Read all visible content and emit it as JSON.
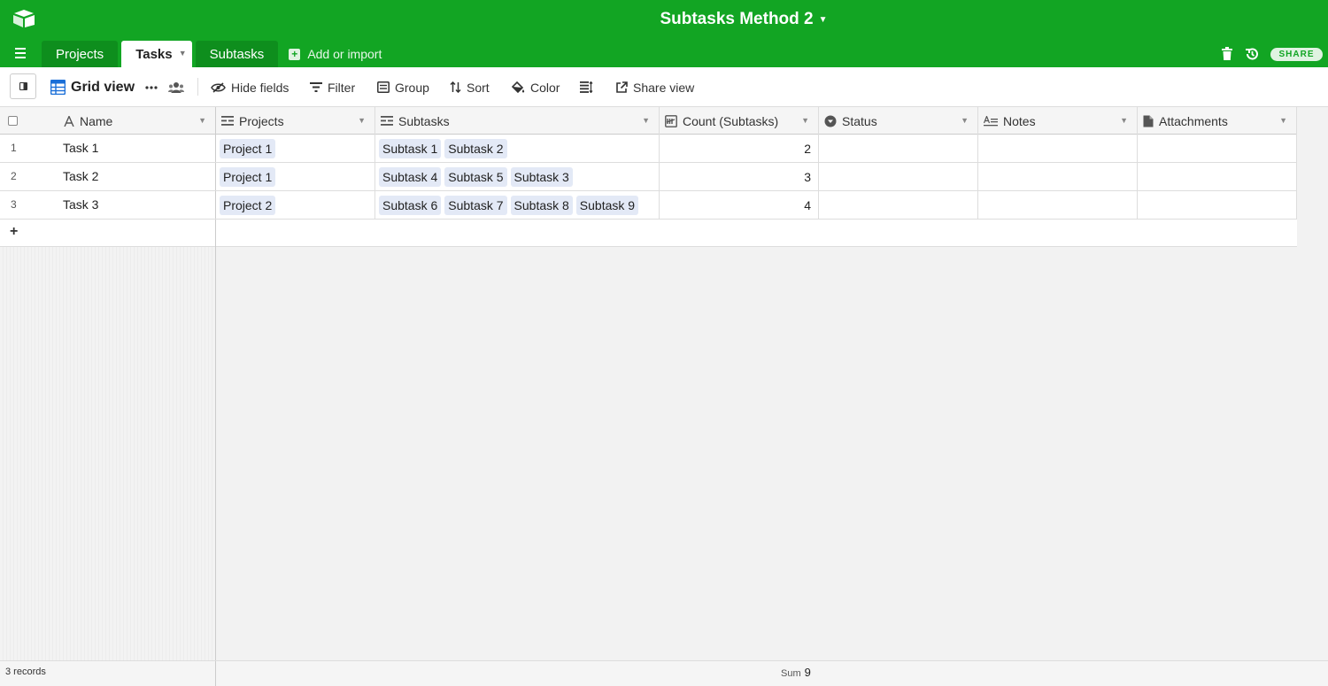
{
  "header": {
    "base_title": "Subtasks Method 2",
    "tabs": [
      {
        "label": "Projects",
        "active": false
      },
      {
        "label": "Tasks",
        "active": true
      },
      {
        "label": "Subtasks",
        "active": false
      }
    ],
    "add_import_label": "Add or import",
    "share_label": "SHARE"
  },
  "toolbar": {
    "view_name": "Grid view",
    "hide_fields": "Hide fields",
    "filter": "Filter",
    "group": "Group",
    "sort": "Sort",
    "color": "Color",
    "share_view": "Share view"
  },
  "grid": {
    "columns": [
      {
        "name": "Name",
        "icon": "text-field-icon"
      },
      {
        "name": "Projects",
        "icon": "linked-record-icon"
      },
      {
        "name": "Subtasks",
        "icon": "linked-record-icon"
      },
      {
        "name": "Count (Subtasks)",
        "icon": "count-field-icon"
      },
      {
        "name": "Status",
        "icon": "single-select-icon"
      },
      {
        "name": "Notes",
        "icon": "long-text-icon"
      },
      {
        "name": "Attachments",
        "icon": "attachment-icon"
      }
    ],
    "rows": [
      {
        "num": "1",
        "name": "Task 1",
        "projects": [
          "Project 1"
        ],
        "subtasks": [
          "Subtask 1",
          "Subtask 2"
        ],
        "count": "2"
      },
      {
        "num": "2",
        "name": "Task 2",
        "projects": [
          "Project 1"
        ],
        "subtasks": [
          "Subtask 4",
          "Subtask 5",
          "Subtask 3"
        ],
        "count": "3"
      },
      {
        "num": "3",
        "name": "Task 3",
        "projects": [
          "Project 2"
        ],
        "subtasks": [
          "Subtask 6",
          "Subtask 7",
          "Subtask 8",
          "Subtask 9"
        ],
        "count": "4"
      }
    ]
  },
  "footer": {
    "records": "3 records",
    "sum_label": "Sum",
    "sum_value": "9"
  },
  "colors": {
    "brand_green": "#12a523",
    "pill_blue": "#e3e9f6"
  }
}
